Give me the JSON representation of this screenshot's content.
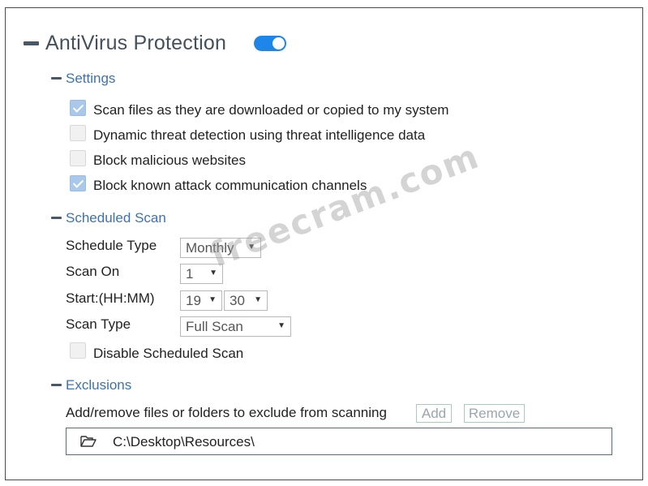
{
  "antivirus": {
    "title": "AntiVirus Protection",
    "enabled": true
  },
  "settings": {
    "title": "Settings",
    "options": [
      {
        "label": "Scan files as they are downloaded or copied to my system",
        "checked": true
      },
      {
        "label": "Dynamic threat detection using threat intelligence data",
        "checked": false
      },
      {
        "label": "Block malicious websites",
        "checked": false
      },
      {
        "label": "Block known attack communication channels",
        "checked": true
      }
    ]
  },
  "scheduled_scan": {
    "title": "Scheduled Scan",
    "schedule_type_label": "Schedule Type",
    "schedule_type_value": "Monthly",
    "scan_on_label": "Scan On",
    "scan_on_value": "1",
    "start_label": "Start:(HH:MM)",
    "start_hour": "19",
    "start_minute": "30",
    "scan_type_label": "Scan Type",
    "scan_type_value": "Full Scan",
    "disable_label": "Disable Scheduled Scan",
    "disable_checked": false
  },
  "exclusions": {
    "title": "Exclusions",
    "description": "Add/remove files or folders to exclude from scanning",
    "add_label": "Add",
    "remove_label": "Remove",
    "items": [
      {
        "path": "C:\\Desktop\\Resources\\",
        "icon": "folder-open-icon"
      }
    ]
  },
  "watermark": "freecram.com",
  "colors": {
    "accent": "#1e86e8",
    "section_title": "#3d72b0",
    "checkbox_checked": "#aac8ea"
  }
}
